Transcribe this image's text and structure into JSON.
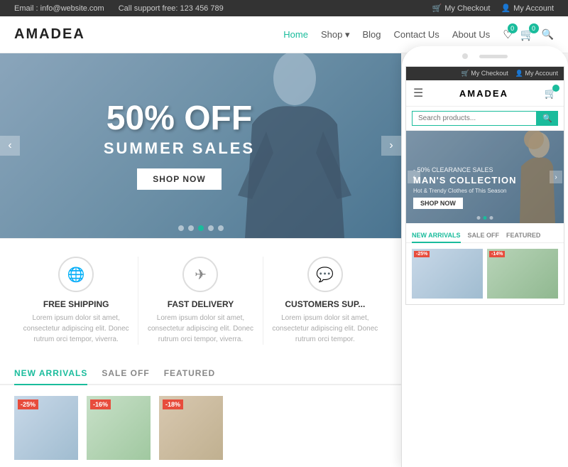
{
  "topbar": {
    "email_label": "Email : info@website.com",
    "phone_label": "Call support free: 123 456 789",
    "checkout_label": "My Checkout",
    "account_label": "My Account"
  },
  "header": {
    "logo": "AMADEA",
    "nav": [
      {
        "label": "Home",
        "active": true
      },
      {
        "label": "Shop",
        "has_dropdown": true
      },
      {
        "label": "Blog"
      },
      {
        "label": "Contact Us"
      },
      {
        "label": "About Us"
      }
    ],
    "cart_count": "0",
    "wishlist_count": "0"
  },
  "hero": {
    "percent": "50% OFF",
    "title": "SUMMER SALES",
    "button": "SHOP NOW",
    "dots": [
      false,
      false,
      true,
      false,
      false
    ]
  },
  "features": [
    {
      "icon": "🌐",
      "title": "FREE SHIPPING",
      "desc": "Lorem ipsum dolor sit amet, consectetur adipiscing elit. Donec rutrum orci tempor, viverra."
    },
    {
      "icon": "✈",
      "title": "FAST DELIVERY",
      "desc": "Lorem ipsum dolor sit amet, consectetur adipiscing elit. Donec rutrum orci tempor, viverra."
    },
    {
      "icon": "💬",
      "title": "CUSTOMERS SUP...",
      "desc": "Lorem ipsum dolor sit amet, consectetur adipiscing elit. Donec rutrum orci tempor."
    }
  ],
  "tabs": {
    "items": [
      "NEW ARRIVALS",
      "SALE OFF",
      "FEATURED"
    ],
    "active": 0
  },
  "products": [
    {
      "discount": "-25%",
      "color": "blue"
    },
    {
      "discount": "-16%",
      "color": "green"
    },
    {
      "discount": "-18%",
      "color": "brown"
    }
  ],
  "phone": {
    "topbar": {
      "checkout": "My Checkout",
      "account": "My Account"
    },
    "logo": "AMADEA",
    "search_placeholder": "Search products...",
    "hero": {
      "small": "- 50% CLEARANCE SALES",
      "title": "MAN'S COLLECTION",
      "subtitle": "Hot & Trendy Clothes of This Season",
      "button": "SHOP NOW"
    },
    "tabs": [
      "NEW ARRIVALS",
      "SALE OFF",
      "FEATURED"
    ],
    "active_tab": 0,
    "products": [
      {
        "discount": "-25%",
        "color": "blue2"
      },
      {
        "discount": "-14%",
        "color": "green2"
      }
    ]
  }
}
